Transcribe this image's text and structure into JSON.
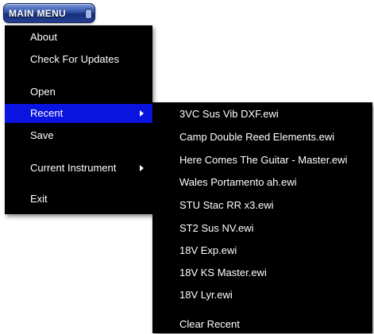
{
  "main_button": {
    "label": "MAIN MENU"
  },
  "main_menu": {
    "about": "About",
    "check_updates": "Check For Updates",
    "open": "Open",
    "recent": "Recent",
    "save": "Save",
    "current_instrument": "Current Instrument",
    "exit": "Exit"
  },
  "recent_menu": {
    "files": [
      "3VC Sus Vib DXF.ewi",
      "Camp Double Reed Elements.ewi",
      "Here Comes The Guitar - Master.ewi",
      "Wales Portamento ah.ewi",
      "STU Stac RR x3.ewi",
      "ST2 Sus NV.ewi",
      "18V Exp.ewi",
      "18V KS Master.ewi",
      "18V Lyr.ewi"
    ],
    "clear": "Clear Recent"
  },
  "colors": {
    "menu_bg": "#000000",
    "highlight": "#0a14e0",
    "text": "#ffffff"
  }
}
